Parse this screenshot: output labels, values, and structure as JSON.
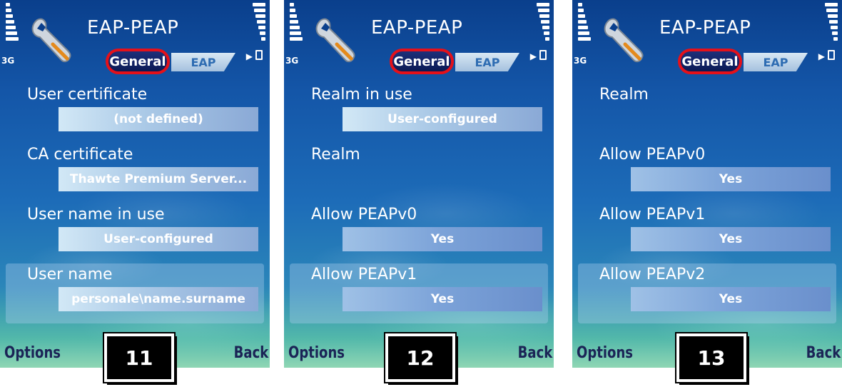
{
  "screens": [
    {
      "title": "EAP-PEAP",
      "network": "3G",
      "tabs": {
        "active": "General",
        "inactive": "EAP"
      },
      "fields": [
        {
          "label": "User certificate",
          "value": "(not defined)"
        },
        {
          "label": "CA certificate",
          "value": "Thawte Premium Server..."
        },
        {
          "label": "User name in use",
          "value": "User-configured"
        },
        {
          "label": "User name",
          "value": "personale\\name.surname"
        }
      ],
      "softkeys": {
        "left": "Options",
        "right": "Back"
      },
      "step": "11"
    },
    {
      "title": "EAP-PEAP",
      "network": "3G",
      "tabs": {
        "active": "General",
        "inactive": "EAP"
      },
      "fields": [
        {
          "label": "Realm in use",
          "value": "User-configured"
        },
        {
          "label": "Realm",
          "value": ""
        },
        {
          "label": "Allow PEAPv0",
          "value": "Yes"
        },
        {
          "label": "Allow PEAPv1",
          "value": "Yes"
        }
      ],
      "softkeys": {
        "left": "Options",
        "right": "Back"
      },
      "step": "12"
    },
    {
      "title": "EAP-PEAP",
      "network": "3G",
      "tabs": {
        "active": "General",
        "inactive": "EAP"
      },
      "fields": [
        {
          "label": "Realm",
          "value": ""
        },
        {
          "label": "Allow PEAPv0",
          "value": "Yes"
        },
        {
          "label": "Allow PEAPv1",
          "value": "Yes"
        },
        {
          "label": "Allow PEAPv2",
          "value": "Yes"
        }
      ],
      "softkeys": {
        "left": "Options",
        "right": "Back"
      },
      "step": "13"
    }
  ],
  "colors": {
    "annotation_circle": "#e4111a",
    "softkey_text": "#1b2456"
  }
}
